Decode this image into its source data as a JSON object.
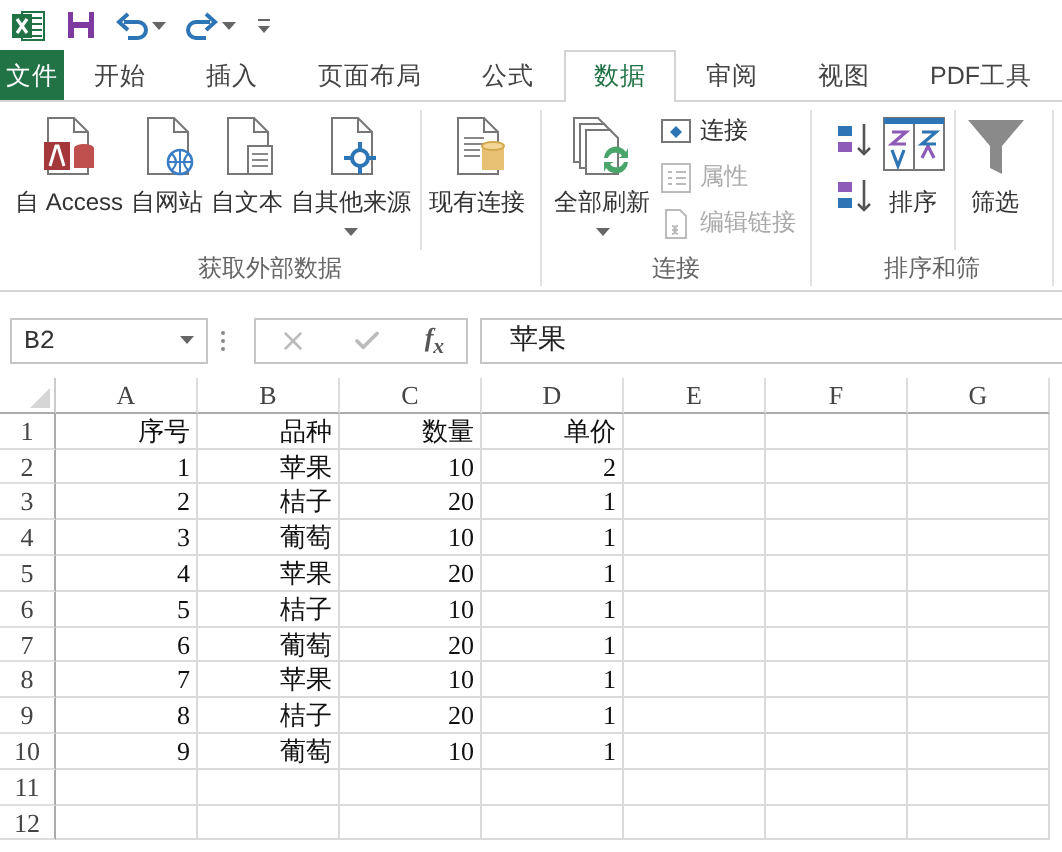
{
  "tabs": [
    {
      "label": "文件",
      "kind": "file",
      "selected": false
    },
    {
      "label": "开始",
      "kind": "tab",
      "selected": false
    },
    {
      "label": "插入",
      "kind": "tab",
      "selected": false
    },
    {
      "label": "页面布局",
      "kind": "tab",
      "selected": false
    },
    {
      "label": "公式",
      "kind": "tab",
      "selected": false
    },
    {
      "label": "数据",
      "kind": "tab",
      "selected": true
    },
    {
      "label": "审阅",
      "kind": "tab",
      "selected": false
    },
    {
      "label": "视图",
      "kind": "tab",
      "selected": false
    },
    {
      "label": "PDF工具",
      "kind": "tab",
      "selected": false
    }
  ],
  "ribbon": {
    "groups": [
      {
        "label": "获取外部数据",
        "sections": [
          [
            {
              "kind": "large",
              "label": "自 Access",
              "dropdown": false,
              "disabled": false
            },
            {
              "kind": "large",
              "label": "自网站",
              "dropdown": false,
              "disabled": false
            },
            {
              "kind": "large",
              "label": "自文本",
              "dropdown": false,
              "disabled": false
            },
            {
              "kind": "large",
              "label": "自其他来源",
              "dropdown": true,
              "disabled": false
            }
          ],
          [
            {
              "kind": "large",
              "label": "现有连接",
              "dropdown": false,
              "disabled": false
            }
          ]
        ]
      },
      {
        "label": "连接",
        "sections": [
          [
            {
              "kind": "large",
              "label": "全部刷新",
              "dropdown": true,
              "disabled": false
            },
            {
              "kind": "small",
              "label": "连接",
              "disabled": false
            },
            {
              "kind": "small",
              "label": "属性",
              "disabled": true
            },
            {
              "kind": "small",
              "label": "编辑链接",
              "disabled": true
            }
          ]
        ]
      },
      {
        "label": "排序和筛",
        "sections": [
          [
            {
              "kind": "sort_pair"
            },
            {
              "kind": "large",
              "label": "排序",
              "dropdown": false,
              "disabled": false
            }
          ],
          [
            {
              "kind": "large",
              "label": "筛选",
              "dropdown": false,
              "disabled": false
            }
          ]
        ]
      }
    ]
  },
  "formula_bar": {
    "name_box": "B2",
    "function_button": "f$_{x}$",
    "formula": "苹果"
  },
  "sheet": {
    "columns": [
      "A",
      "B",
      "C",
      "D",
      "E",
      "F",
      "G"
    ],
    "rows": [
      {
        "header": "1",
        "cells": [
          "序号",
          "品种",
          "数量",
          "单价"
        ]
      },
      {
        "header": "2",
        "cells": [
          "1",
          "苹果",
          "10",
          "2"
        ]
      },
      {
        "header": "3",
        "cells": [
          "2",
          "桔子",
          "20",
          "1"
        ]
      },
      {
        "header": "4",
        "cells": [
          "3",
          "葡萄",
          "10",
          "1"
        ]
      },
      {
        "header": "5",
        "cells": [
          "4",
          "苹果",
          "20",
          "1"
        ]
      },
      {
        "header": "6",
        "cells": [
          "5",
          "桔子",
          "10",
          "1"
        ]
      },
      {
        "header": "7",
        "cells": [
          "6",
          "葡萄",
          "20",
          "1"
        ]
      },
      {
        "header": "8",
        "cells": [
          "7",
          "苹果",
          "10",
          "1"
        ]
      },
      {
        "header": "9",
        "cells": [
          "8",
          "桔子",
          "20",
          "1"
        ]
      },
      {
        "header": "10",
        "cells": [
          "9",
          "葡萄",
          "10",
          "1"
        ]
      },
      {
        "header": "11"
      },
      {
        "header": "12"
      }
    ]
  }
}
